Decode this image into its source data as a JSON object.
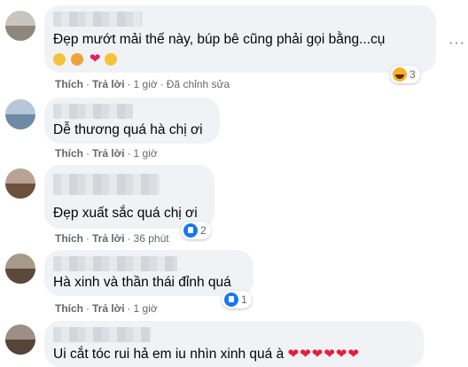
{
  "comments": [
    {
      "text": "Đẹp mướt mải thế này, búp bê cũng phải gọi bằng...cụ",
      "like_label": "Thích",
      "reply_label": "Trả lời",
      "time": "1 giờ",
      "edited": "Đã chỉnh sửa",
      "reaction_count": "3",
      "reaction_icon": "haha-icon",
      "emoji_icons": [
        "heart-eyes-face-icon",
        "heart-eyes-face-icon",
        "red-heart-icon",
        "kissing-face-icon"
      ]
    },
    {
      "text": "Dễ thương quá hà chị ơi",
      "like_label": "Thích",
      "reply_label": "Trả lời",
      "time": "1 giờ"
    },
    {
      "text": "Đẹp xuất sắc quá chị ơi",
      "like_label": "Thích",
      "reply_label": "Trả lời",
      "time": "36 phút",
      "reaction_count": "2",
      "reaction_icon": "like-icon"
    },
    {
      "text": "Hà xinh và thần thái đỉnh quá",
      "like_label": "Thích",
      "reply_label": "Trả lời",
      "time": "1 giờ",
      "reaction_count": "1",
      "reaction_icon": "like-icon"
    },
    {
      "text": "Ui cắt tóc rui hả em iu nhìn xinh quá à",
      "hearts": "❤❤❤❤❤❤"
    }
  ],
  "colors": {
    "bubble": "#f0f2f5",
    "meta_text": "#65676b",
    "like_blue": "#1877f2",
    "heart_red": "#e41e3f"
  }
}
